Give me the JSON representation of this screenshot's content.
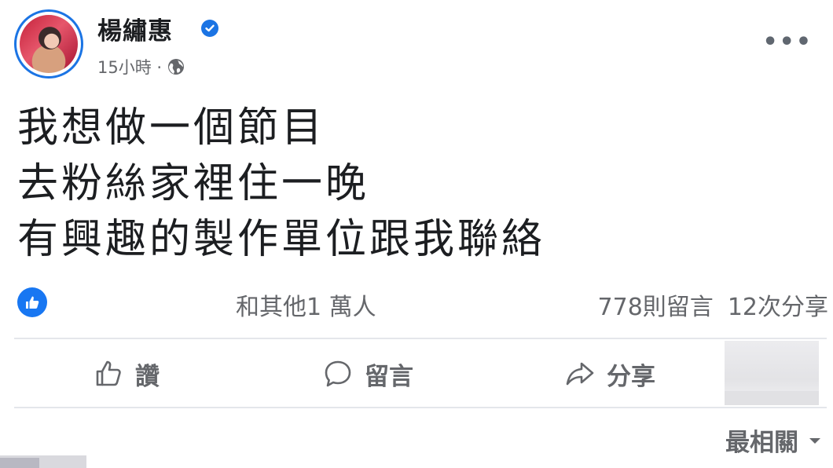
{
  "post": {
    "author": "楊繡惠",
    "timestamp": "15小時 ·",
    "lines": [
      "我想做一個節目",
      "去粉絲家裡住一晚",
      "有興趣的製作單位跟我聯絡"
    ]
  },
  "stats": {
    "reactions": "和其他1 萬人",
    "comments": "778則留言",
    "shares": "12次分享"
  },
  "actions": {
    "like": "讚",
    "comment": "留言",
    "share": "分享"
  },
  "sort": {
    "label": "最相關"
  },
  "colors": {
    "accent": "#1877f2",
    "muted": "#65676b",
    "text": "#1c1e21"
  },
  "icons": [
    "verified-badge-icon",
    "globe-icon",
    "more-options-icon",
    "like-reaction-icon",
    "thumbs-up-icon",
    "comment-bubble-icon",
    "share-arrow-icon",
    "dropdown-arrow-icon"
  ]
}
